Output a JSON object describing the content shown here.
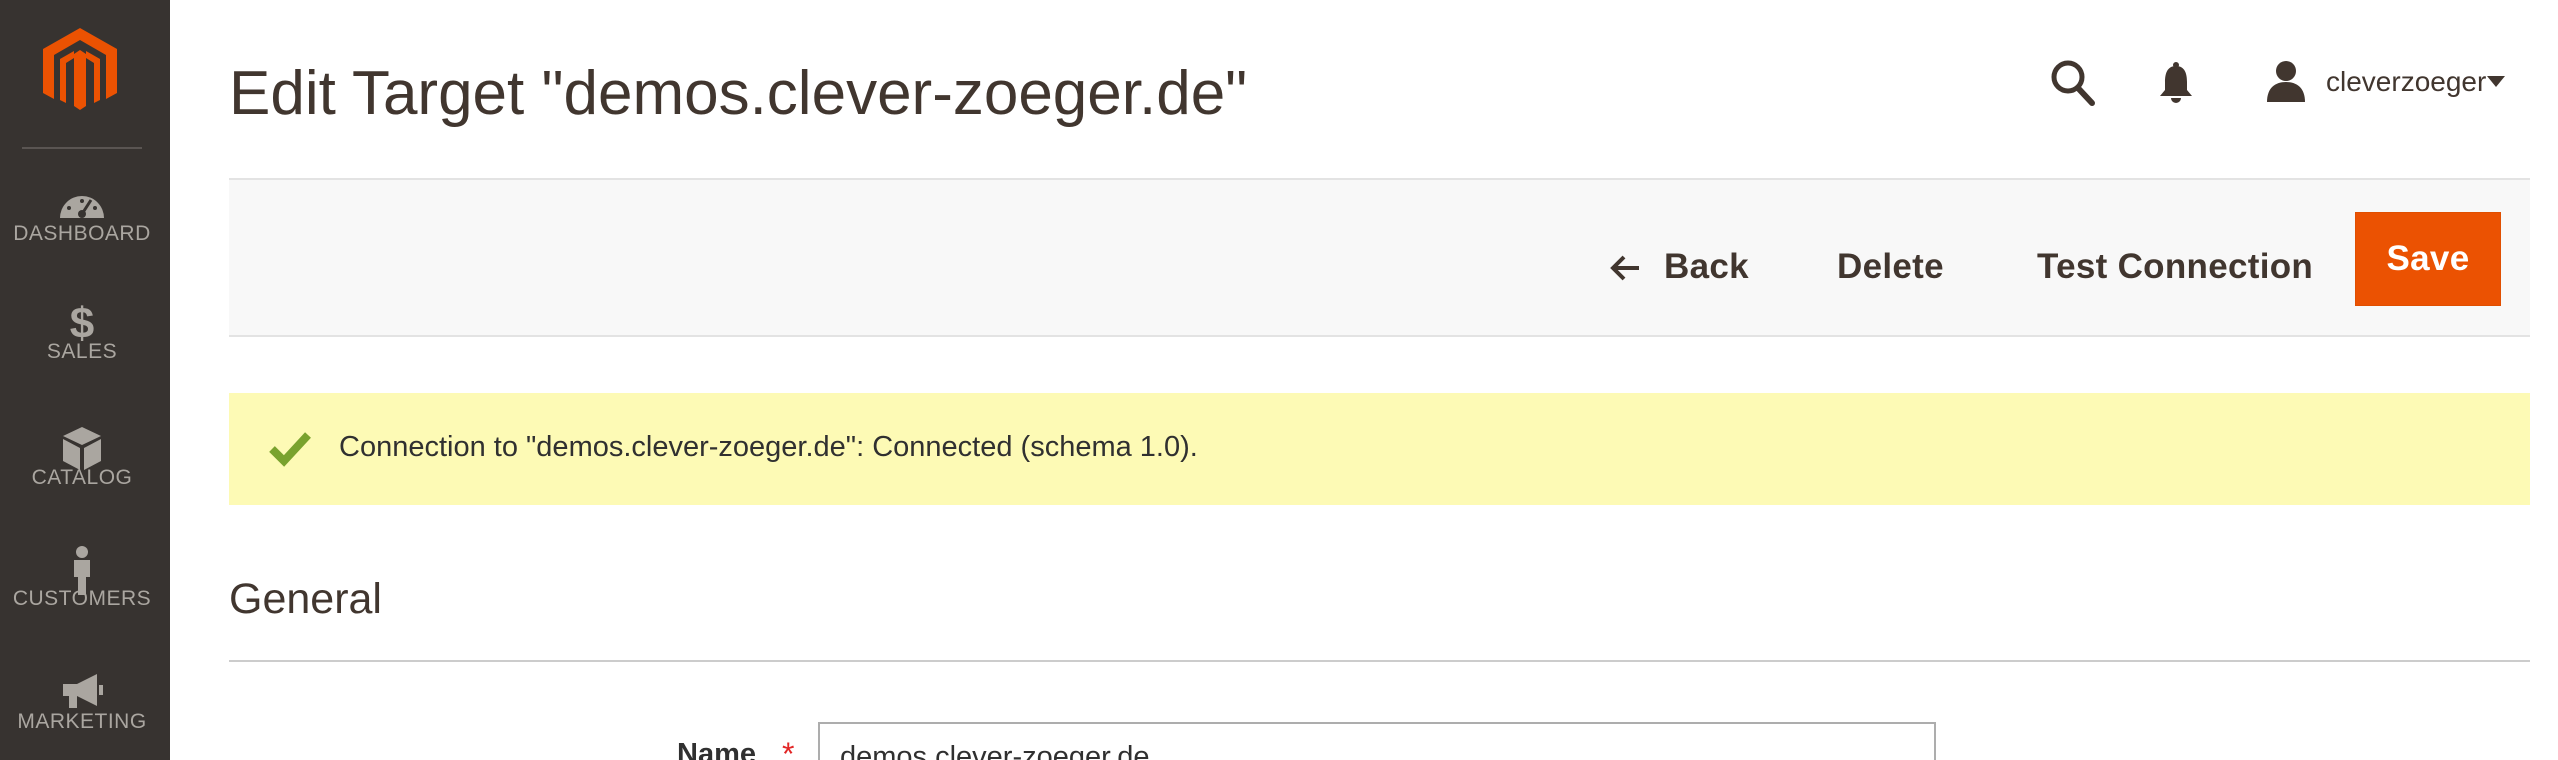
{
  "sidebar": {
    "logo_icon": "magento-logo-icon",
    "items": [
      {
        "label": "DASHBOARD",
        "icon": "dashboard-gauge-icon"
      },
      {
        "label": "SALES",
        "icon": "dollar-icon"
      },
      {
        "label": "CATALOG",
        "icon": "box-icon"
      },
      {
        "label": "CUSTOMERS",
        "icon": "person-icon"
      },
      {
        "label": "MARKETING",
        "icon": "megaphone-icon"
      }
    ]
  },
  "header": {
    "title": "Edit Target \"demos.clever-zoeger.de\"",
    "search_icon": "search-icon",
    "notifications_icon": "bell-icon",
    "user": {
      "name": "cleverzoeger",
      "icon": "user-icon"
    }
  },
  "toolbar": {
    "back_label": "Back",
    "delete_label": "Delete",
    "test_connection_label": "Test Connection",
    "save_label": "Save"
  },
  "message": {
    "type": "success",
    "icon": "checkmark-icon",
    "text": "Connection to \"demos.clever-zoeger.de\": Connected (schema 1.0)."
  },
  "section": {
    "title": "General"
  },
  "form": {
    "name_label": "Name",
    "name_required": "*",
    "name_value": "demos.clever-zoeger.de"
  },
  "colors": {
    "sidebar_bg": "#373330",
    "accent": "#eb5202",
    "message_bg": "#fdfab5",
    "success_icon": "#79a22e"
  }
}
